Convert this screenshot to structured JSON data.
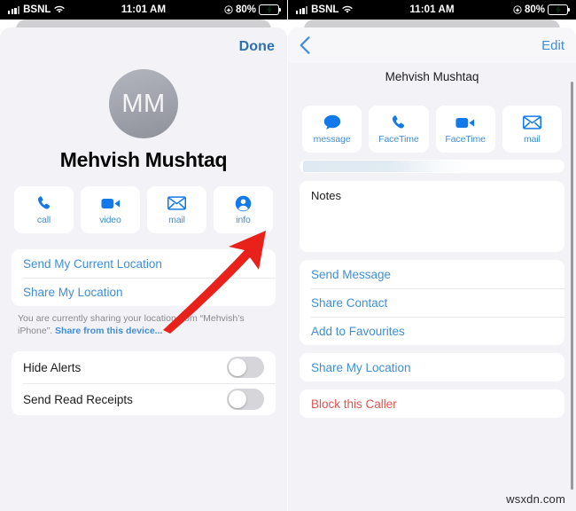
{
  "statusbar": {
    "carrier": "BSNL",
    "time": "11:01 AM",
    "battery_percent": "80%",
    "wifi_icon": "wifi-icon",
    "signal_icon": "cellular-signal-icon",
    "location_icon": "location-services-icon",
    "battery_icon": "battery-charging-icon",
    "battery_color": "#32d74b"
  },
  "theme": {
    "accent_blue": "#3e8ed8",
    "nav_blue": "#2f6fad",
    "danger_red": "#e0544e",
    "sheet_bg": "#f2f2f7",
    "card_bg": "#ffffff",
    "arrow_red": "#e8211a"
  },
  "left_panel": {
    "done_label": "Done",
    "avatar_initials": "MM",
    "contact_name": "Mehvish Mushtaq",
    "actions": [
      {
        "label": "call",
        "icon": "phone-icon"
      },
      {
        "label": "video",
        "icon": "video-camera-icon"
      },
      {
        "label": "mail",
        "icon": "envelope-icon"
      },
      {
        "label": "info",
        "icon": "person-circle-icon"
      }
    ],
    "location_rows": [
      "Send My Current Location",
      "Share My Location"
    ],
    "helper_text": "You are currently sharing your location from “Mehvish’s iPhone”. ",
    "helper_link": "Share from this device...",
    "toggles": [
      {
        "label": "Hide Alerts",
        "on": false
      },
      {
        "label": "Send Read Receipts",
        "on": false
      }
    ]
  },
  "right_panel": {
    "back_icon": "chevron-left-icon",
    "edit_label": "Edit",
    "title": "Mehvish Mushtaq",
    "actions": [
      {
        "label": "message",
        "icon": "message-bubble-icon"
      },
      {
        "label": "FaceTime",
        "icon": "phone-icon"
      },
      {
        "label": "FaceTime",
        "icon": "video-camera-icon"
      },
      {
        "label": "mail",
        "icon": "envelope-icon"
      }
    ],
    "notes_label": "Notes",
    "menu_rows": [
      "Send Message",
      "Share Contact",
      "Add to Favourites"
    ],
    "share_location_row": "Share My Location",
    "block_row": "Block this Caller"
  },
  "watermark": "wsxdn.com"
}
